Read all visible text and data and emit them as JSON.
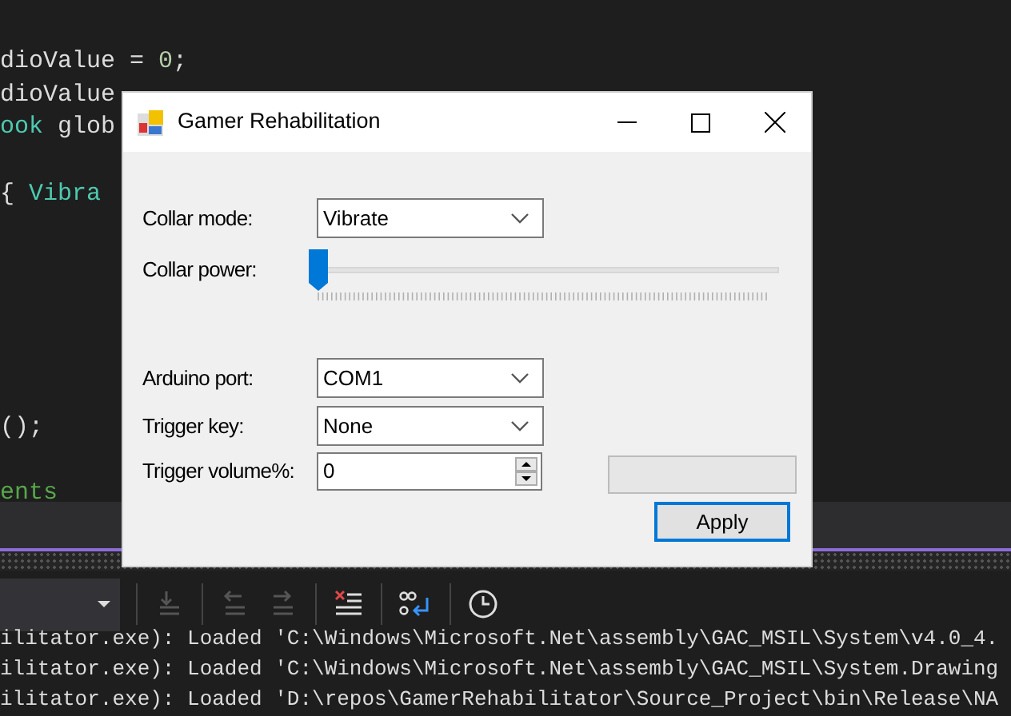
{
  "editor": {
    "lines": [
      [
        {
          "text": "dioValue = ",
          "kind": "plain"
        },
        {
          "text": "0",
          "kind": "number"
        },
        {
          "text": ";",
          "kind": "plain"
        }
      ],
      [
        {
          "text": "dioValue",
          "kind": "plain"
        }
      ],
      [
        {
          "text": "ook",
          "kind": "type"
        },
        {
          "text": " glob",
          "kind": "plain"
        }
      ],
      [
        {
          "text": "{ ",
          "kind": "plain"
        },
        {
          "text": "Vibra",
          "kind": "type"
        }
      ],
      [
        {
          "text": "();",
          "kind": "plain"
        }
      ],
      [
        {
          "text": "ents",
          "kind": "comment"
        }
      ]
    ]
  },
  "dialog": {
    "title": "Gamer Rehabilitation",
    "fields": [
      {
        "kind": "combo",
        "label": "Collar mode:",
        "value": "Vibrate"
      },
      {
        "kind": "slider",
        "label": "Collar power:",
        "level": 0
      },
      {
        "kind": "combo",
        "label": "Arduino port:",
        "value": "COM1"
      },
      {
        "kind": "combo",
        "label": "Trigger key:",
        "value": "None"
      },
      {
        "kind": "spin",
        "label": "Trigger volume%:",
        "value": "0"
      }
    ],
    "progress": {
      "level": 0
    },
    "apply_button": "Apply"
  },
  "output": {
    "lines": [
      "ilitator.exe): Loaded 'C:\\Windows\\Microsoft.Net\\assembly\\GAC_MSIL\\System\\v4.0_4.",
      "ilitator.exe): Loaded 'C:\\Windows\\Microsoft.Net\\assembly\\GAC_MSIL\\System.Drawing",
      "ilitator.exe): Loaded 'D:\\repos\\GamerRehabilitator\\Source_Project\\bin\\Release\\NA"
    ]
  }
}
